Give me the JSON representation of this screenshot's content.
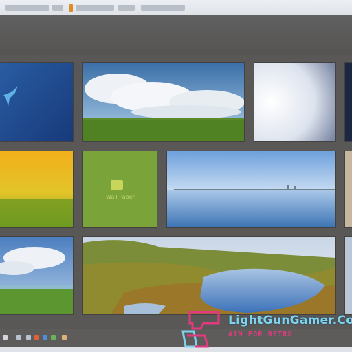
{
  "window": {
    "title": ""
  },
  "gallery": {
    "tiles": [
      {
        "name": "tile-blue-bird",
        "caption": ""
      },
      {
        "name": "tile-cloudy-meadow",
        "caption": ""
      },
      {
        "name": "tile-gradient-sky",
        "caption": ""
      },
      {
        "name": "tile-yellow-field",
        "caption": ""
      },
      {
        "name": "tile-green-folder",
        "caption": "Wall Paper"
      },
      {
        "name": "tile-calm-lake",
        "caption": ""
      },
      {
        "name": "tile-grass-sky",
        "caption": ""
      },
      {
        "name": "tile-tundra-pond",
        "caption": ""
      }
    ]
  },
  "watermark": {
    "title": "LightGunGamer.Com",
    "subtitle": "AIM FOR RETRO"
  },
  "colors": {
    "background": "#5a5856",
    "topbar": "#e4e8ec",
    "accent_orange": "#e08a2c",
    "watermark_cyan": "#7fd2ee",
    "watermark_pink": "#e2397f"
  }
}
